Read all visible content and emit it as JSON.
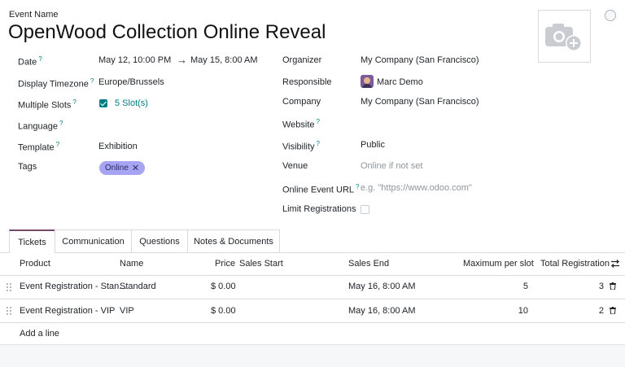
{
  "header": {
    "field_label": "Event Name",
    "title": "OpenWood Collection Online Reveal"
  },
  "left": {
    "date": {
      "label": "Date",
      "start": "May 12, 10:00 PM",
      "arrow": "→",
      "end": "May 15, 8:00 AM"
    },
    "timezone": {
      "label": "Display Timezone",
      "value": "Europe/Brussels"
    },
    "slots": {
      "label": "Multiple Slots",
      "link": "5 Slot(s)"
    },
    "language": {
      "label": "Language",
      "value": ""
    },
    "template": {
      "label": "Template",
      "value": "Exhibition"
    },
    "tags": {
      "label": "Tags",
      "items": [
        "Online"
      ]
    }
  },
  "right": {
    "organizer": {
      "label": "Organizer",
      "value": "My Company (San Francisco)"
    },
    "responsible": {
      "label": "Responsible",
      "value": "Marc Demo"
    },
    "company": {
      "label": "Company",
      "value": "My Company (San Francisco)"
    },
    "website": {
      "label": "Website",
      "value": ""
    },
    "visibility": {
      "label": "Visibility",
      "value": "Public"
    },
    "venue": {
      "label": "Venue",
      "placeholder": "Online if not set"
    },
    "online_url": {
      "label": "Online Event URL",
      "placeholder": "e.g. \"https://www.odoo.com\""
    },
    "limit": {
      "label": "Limit Registrations"
    }
  },
  "help_marker": "?",
  "tabs": [
    "Tickets",
    "Communication",
    "Questions",
    "Notes & Documents"
  ],
  "table": {
    "columns": [
      "Product",
      "Name",
      "Price",
      "Sales Start",
      "Sales End",
      "Maximum per slot",
      "Total Registration"
    ],
    "rows": [
      {
        "product": "Event Registration - Stan...",
        "name": "Standard",
        "price": "$ 0.00",
        "sales_start": "",
        "sales_end": "May 16, 8:00 AM",
        "max": "5",
        "total": "3"
      },
      {
        "product": "Event Registration - VIP",
        "name": "VIP",
        "price": "$ 0.00",
        "sales_start": "",
        "sales_end": "May 16, 8:00 AM",
        "max": "10",
        "total": "2"
      }
    ],
    "add_line": "Add a line"
  },
  "colors": {
    "accent": "#017e84",
    "tab_active": "#714b67",
    "tag": "#a7a5f3"
  }
}
